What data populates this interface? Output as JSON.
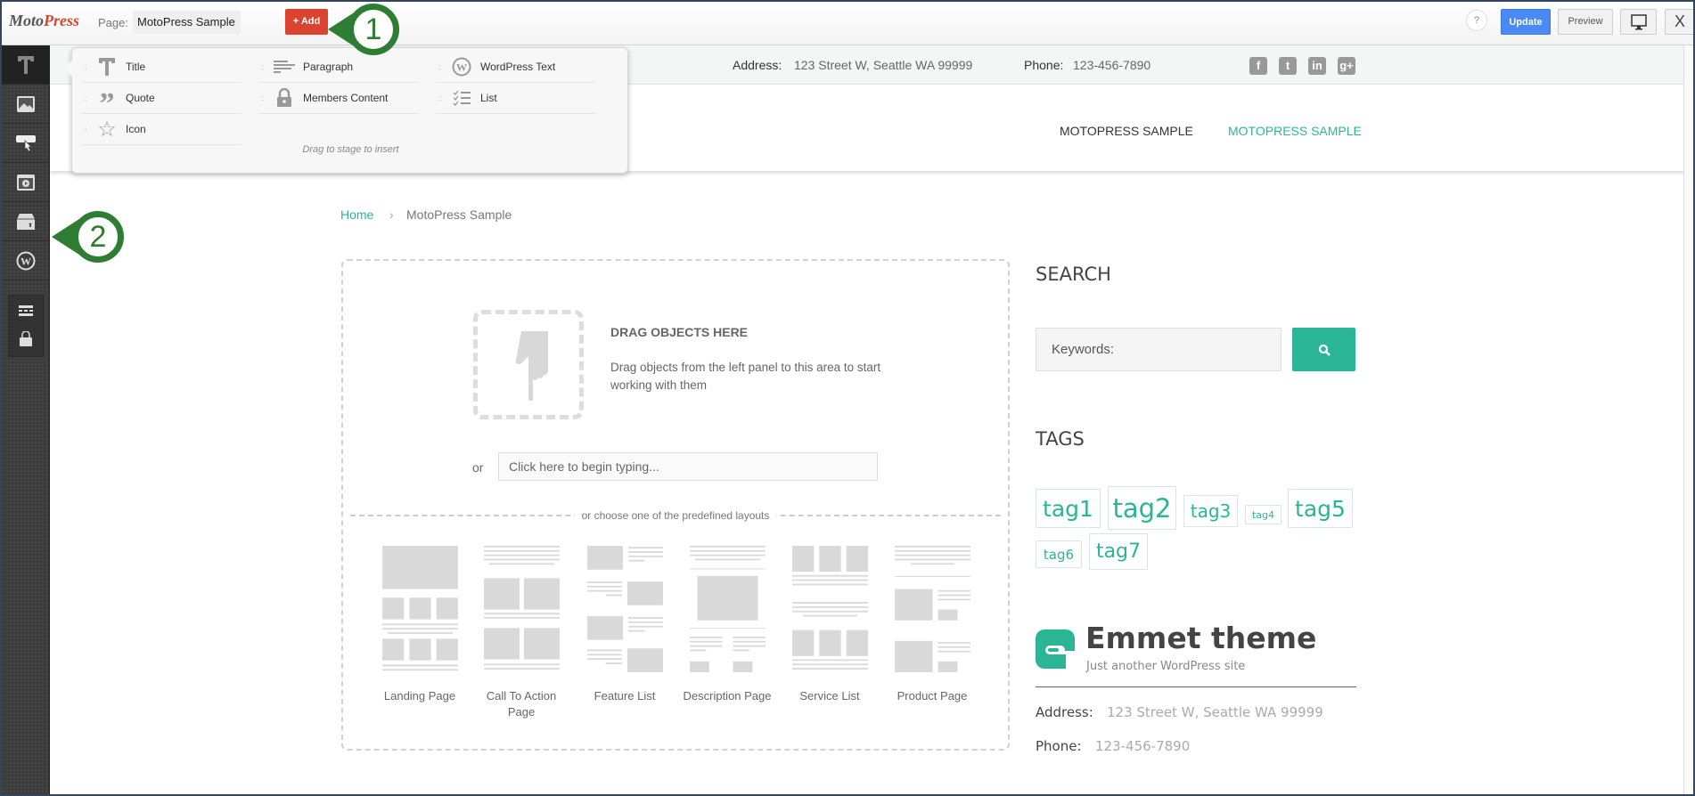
{
  "topbar": {
    "logo": {
      "part1": "Moto",
      "part2": "Press"
    },
    "page_label": "Page:",
    "page_name": "MotoPress Sample",
    "add_label": "+ Add",
    "help_label": "?",
    "update_label": "Update",
    "preview_label": "Preview",
    "close_label": "X"
  },
  "callouts": {
    "one": "1",
    "two": "2"
  },
  "sidebar": {
    "items": [
      {
        "icon": "text-icon",
        "active": true
      },
      {
        "icon": "image-icon"
      },
      {
        "icon": "button-click-icon"
      },
      {
        "icon": "media-icon"
      },
      {
        "icon": "box-icon"
      },
      {
        "icon": "wordpress-icon"
      },
      {
        "icon": "layout-icon"
      },
      {
        "icon": "bag-icon"
      }
    ]
  },
  "popup": {
    "items": [
      {
        "label": "Title",
        "icon": "title-icon"
      },
      {
        "label": "Paragraph",
        "icon": "paragraph-icon"
      },
      {
        "label": "WordPress Text",
        "icon": "wordpress-icon"
      },
      {
        "label": "Quote",
        "icon": "quote-icon"
      },
      {
        "label": "Members Content",
        "icon": "lock-icon"
      },
      {
        "label": "List",
        "icon": "list-icon"
      },
      {
        "label": "Icon",
        "icon": "star-icon"
      }
    ],
    "hint": "Drag to stage to insert"
  },
  "site": {
    "info": {
      "address_label": "Address:",
      "address": "123 Street W, Seattle WA 99999",
      "phone_label": "Phone:",
      "phone": "123-456-7890"
    },
    "social": [
      "f",
      "t",
      "in",
      "g+"
    ],
    "nav": [
      "MOTOPRESS SAMPLE",
      "MOTOPRESS SAMPLE"
    ],
    "breadcrumb": {
      "home": "Home",
      "sep": "›",
      "current": "MotoPress Sample"
    },
    "accent": "#2bb597"
  },
  "stage": {
    "drop_title": "DRAG OBJECTS HERE",
    "drop_desc": "Drag objects from the left panel to this area to start working with them",
    "or": "or",
    "type_placeholder": "Click here to begin typing...",
    "layouts_divider": "or choose one of the predefined layouts",
    "layouts": [
      "Landing Page",
      "Call To Action Page",
      "Feature List",
      "Description Page",
      "Service List",
      "Product Page"
    ]
  },
  "widgets": {
    "search_title": "SEARCH",
    "search_placeholder": "Keywords:",
    "tags_title": "TAGS",
    "tags": [
      "tag1",
      "tag2",
      "tag3",
      "tag4",
      "tag5",
      "tag6",
      "tag7"
    ],
    "brand": "Emmet theme",
    "tagline": "Just another WordPress site",
    "address_label": "Address:",
    "address": "123 Street W, Seattle WA 99999",
    "phone_label": "Phone:",
    "phone": "123-456-7890"
  }
}
